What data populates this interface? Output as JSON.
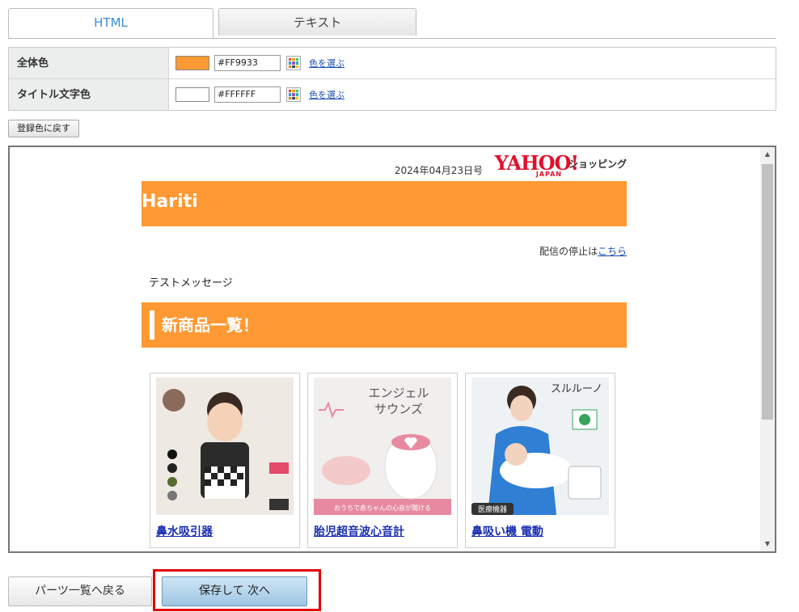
{
  "tabs": [
    {
      "label": "HTML",
      "active": true
    },
    {
      "label": "テキスト",
      "active": false
    }
  ],
  "settings": {
    "rows": [
      {
        "label": "全体色",
        "hex": "#FF9933",
        "swatch": "#ff9933",
        "pick_label": "色を選ぶ"
      },
      {
        "label": "タイトル文字色",
        "hex": "#FFFFFF",
        "swatch": "#ffffff",
        "pick_label": "色を選ぶ"
      }
    ]
  },
  "reset_button": "登録色に戻す",
  "preview": {
    "issue_date": "2024年04月23日号",
    "logo_text": "YAHOO!",
    "logo_sub": "JAPAN",
    "shopping_text": "ショッピング",
    "store_title": "Hariti",
    "unsubscribe_prefix": "配信の停止は",
    "unsubscribe_link": "こちら",
    "message": "テストメッセージ",
    "section_title": "新商品一覧！",
    "products": [
      {
        "name": "鼻水吸引器"
      },
      {
        "name": "胎児超音波心音計",
        "image_text_1": "エンジェル",
        "image_text_2": "サウンズ",
        "image_caption": "おうちで赤ちゃんの心音が聞ける"
      },
      {
        "name": "鼻吸い機 電動",
        "image_text_1": "スルルーノ",
        "image_badge": "医療機器"
      }
    ]
  },
  "buttons": {
    "back": "パーツ一覧へ戻る",
    "save": "保存して 次へ"
  },
  "colors": {
    "accent": "#ff9933",
    "link": "#1a4db3",
    "highlight": "#e00000"
  }
}
